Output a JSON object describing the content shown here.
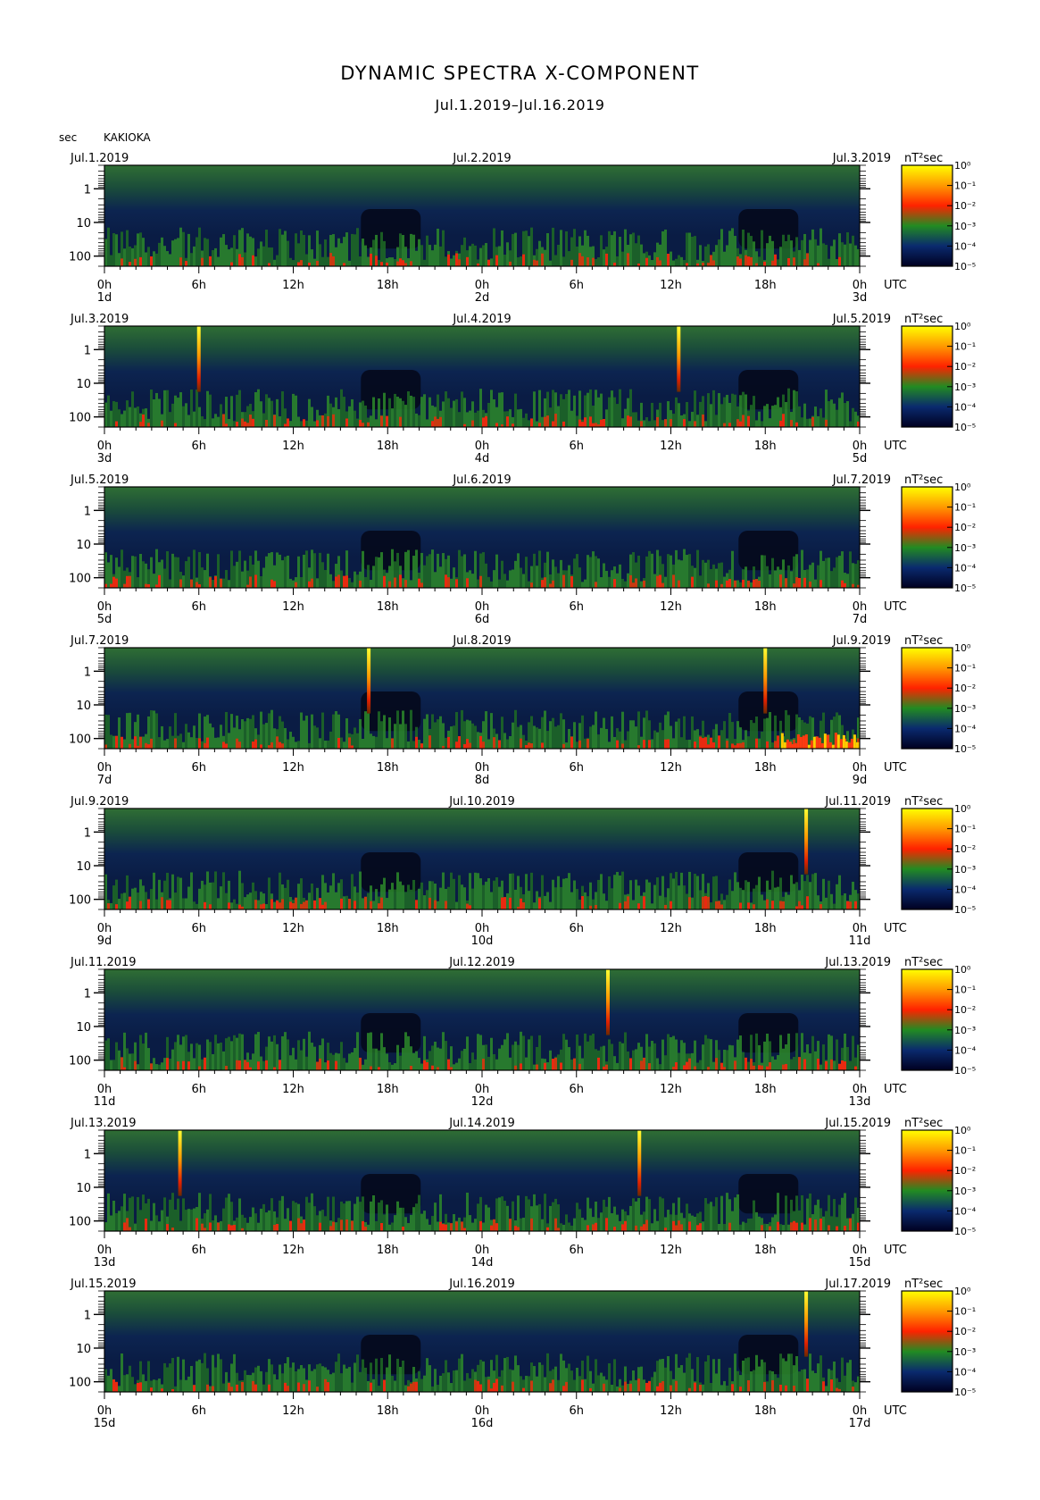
{
  "header": {
    "title": "DYNAMIC SPECTRA X-COMPONENT",
    "subtitle": "Jul.1.2019–Jul.16.2019",
    "unit": "sec",
    "station": "KAKIOKA"
  },
  "chart_data": {
    "type": "heatmap",
    "title": "DYNAMIC SPECTRA X-COMPONENT",
    "subtitle": "Jul.1.2019–Jul.16.2019",
    "ylabel": "sec",
    "yscale": "log",
    "ytick_labels": [
      "1",
      "10",
      "100"
    ],
    "ylim": [
      0.2,
      200
    ],
    "xtick_labels": [
      "0h",
      "6h",
      "12h",
      "18h",
      "0h",
      "6h",
      "12h",
      "18h",
      "0h"
    ],
    "x_unit": "UTC",
    "colorbar": {
      "label": "nT²sec",
      "ticks": [
        "10⁰",
        "10⁻¹",
        "10⁻²",
        "10⁻³",
        "10⁻⁴",
        "10⁻⁵"
      ],
      "colors": [
        "#ffff00",
        "#ff9900",
        "#ff2200",
        "#228b22",
        "#0a2a6e",
        "#000020"
      ]
    },
    "panels": [
      {
        "left_date": "Jul.1.2019",
        "mid_date": "Jul.2.2019",
        "right_date": "Jul.3.2019",
        "day_labels": [
          "1d",
          "2d",
          "3d"
        ],
        "spikes_h": [],
        "storm_from_h": null
      },
      {
        "left_date": "Jul.3.2019",
        "mid_date": "Jul.4.2019",
        "right_date": "Jul.5.2019",
        "day_labels": [
          "3d",
          "4d",
          "5d"
        ],
        "spikes_h": [
          6.0,
          36.5
        ],
        "storm_from_h": null
      },
      {
        "left_date": "Jul.5.2019",
        "mid_date": "Jul.6.2019",
        "right_date": "Jul.7.2019",
        "day_labels": [
          "5d",
          "6d",
          "7d"
        ],
        "spikes_h": [],
        "storm_from_h": null
      },
      {
        "left_date": "Jul.7.2019",
        "mid_date": "Jul.8.2019",
        "right_date": "Jul.9.2019",
        "day_labels": [
          "7d",
          "8d",
          "9d"
        ],
        "spikes_h": [
          16.8,
          42.0
        ],
        "storm_from_h": 43.0
      },
      {
        "left_date": "Jul.9.2019",
        "mid_date": "Jul.10.2019",
        "right_date": "Jul.11.2019",
        "day_labels": [
          "9d",
          "10d",
          "11d"
        ],
        "spikes_h": [
          44.6
        ],
        "storm_from_h": null
      },
      {
        "left_date": "Jul.11.2019",
        "mid_date": "Jul.12.2019",
        "right_date": "Jul.13.2019",
        "day_labels": [
          "11d",
          "12d",
          "13d"
        ],
        "spikes_h": [
          32.0
        ],
        "storm_from_h": null
      },
      {
        "left_date": "Jul.13.2019",
        "mid_date": "Jul.14.2019",
        "right_date": "Jul.15.2019",
        "day_labels": [
          "13d",
          "14d",
          "15d"
        ],
        "spikes_h": [
          4.8,
          34.0
        ],
        "storm_from_h": null
      },
      {
        "left_date": "Jul.15.2019",
        "mid_date": "Jul.16.2019",
        "right_date": "Jul.17.2019",
        "day_labels": [
          "15d",
          "16d",
          "17d"
        ],
        "spikes_h": [
          44.6
        ],
        "storm_from_h": null
      }
    ]
  }
}
